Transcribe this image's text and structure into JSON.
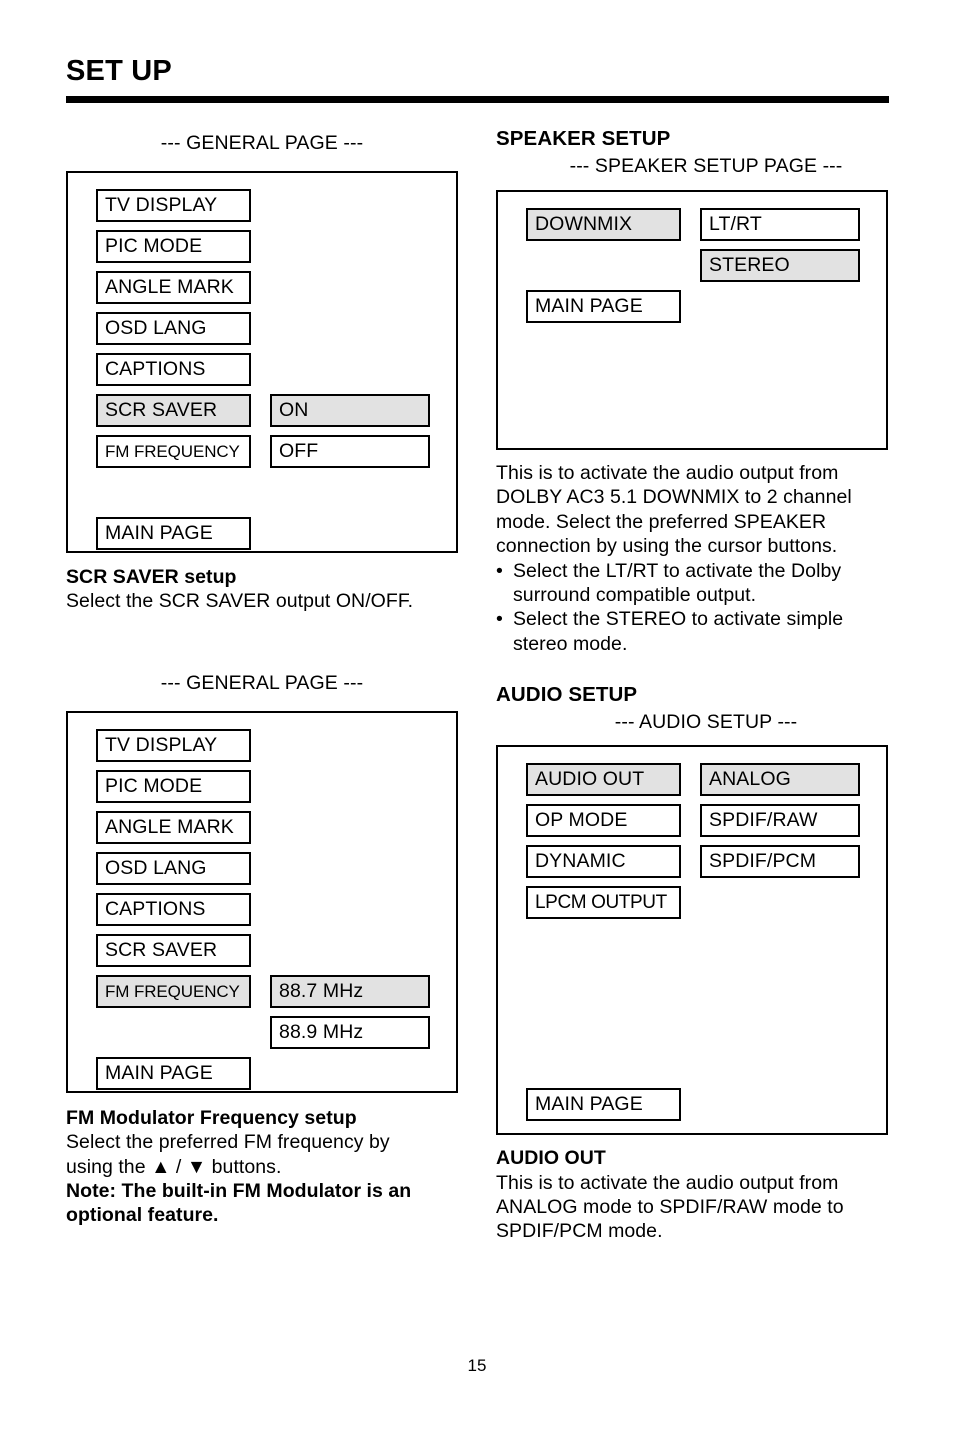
{
  "document": {
    "title": "SET UP",
    "page_number": "15"
  },
  "left_column": {
    "screen1": {
      "caption": "--- GENERAL PAGE ---",
      "menu_items": [
        {
          "label": "TV DISPLAY",
          "selected": false
        },
        {
          "label": "PIC MODE",
          "selected": false
        },
        {
          "label": "ANGLE MARK",
          "selected": false
        },
        {
          "label": "OSD LANG",
          "selected": false
        },
        {
          "label": "CAPTIONS",
          "selected": false
        },
        {
          "label": "SCR SAVER",
          "selected": true
        },
        {
          "label": "FM FREQUENCY",
          "selected": false
        }
      ],
      "main_page_label": "MAIN PAGE",
      "option_items": [
        {
          "label": "ON",
          "selected": true
        },
        {
          "label": "OFF",
          "selected": false
        }
      ]
    },
    "description1": {
      "heading_bold": "SCR SAVER",
      "heading_rest": " setup",
      "line1": "Select the SCR SAVER output ON/OFF."
    },
    "screen2": {
      "caption": "--- GENERAL PAGE ---",
      "menu_items": [
        {
          "label": "TV DISPLAY",
          "selected": false
        },
        {
          "label": "PIC MODE",
          "selected": false
        },
        {
          "label": "ANGLE MARK",
          "selected": false
        },
        {
          "label": "OSD LANG",
          "selected": false
        },
        {
          "label": "CAPTIONS",
          "selected": false
        },
        {
          "label": "SCR SAVER",
          "selected": false
        },
        {
          "label": "FM FREQUENCY",
          "selected": true
        }
      ],
      "main_page_label": "MAIN PAGE",
      "option_items": [
        {
          "label": "88.7 MHz",
          "selected": true
        },
        {
          "label": "88.9 MHz",
          "selected": false
        }
      ]
    },
    "description2": {
      "heading": "FM Modulator Frequency setup",
      "line1": "Select the preferred FM frequency by",
      "line2_pre": "using the ",
      "line2_up": "▲",
      "line2_mid": " / ",
      "line2_down": "▼",
      "line2_post": " buttons.",
      "note_line1": "Note:  The built-in FM Modulator is an",
      "note_line2": "optional feature."
    }
  },
  "right_column": {
    "speaker_setup": {
      "heading": "SPEAKER SETUP",
      "caption": "--- SPEAKER SETUP PAGE ---",
      "menu_items": [
        {
          "label": "DOWNMIX",
          "selected": true
        }
      ],
      "main_page_label": "MAIN PAGE",
      "option_items": [
        {
          "label": "LT/RT",
          "selected": false
        },
        {
          "label": "STEREO",
          "selected": true
        }
      ],
      "description": {
        "line1": "This is to activate the audio output from",
        "line2": "DOLBY AC3 5.1 DOWNMIX to 2 channel",
        "line3": "mode.  Select the preferred SPEAKER",
        "line4": "connection by using the cursor buttons.",
        "bullets": [
          {
            "bullet": "•",
            "line1": "Select the LT/RT to activate the Dolby",
            "line2": "surround compatible output."
          },
          {
            "bullet": "•",
            "line1": "Select the STEREO to activate simple",
            "line2": "stereo mode."
          }
        ]
      }
    },
    "audio_setup": {
      "heading": "AUDIO SETUP",
      "caption": "--- AUDIO SETUP ---",
      "menu_items": [
        {
          "label": "AUDIO OUT",
          "selected": true
        },
        {
          "label": "OP MODE",
          "selected": false
        },
        {
          "label": "DYNAMIC",
          "selected": false
        },
        {
          "label": "LPCM OUTPUT",
          "selected": false
        }
      ],
      "main_page_label": "MAIN PAGE",
      "option_items": [
        {
          "label": "ANALOG",
          "selected": true
        },
        {
          "label": "SPDIF/RAW",
          "selected": false
        },
        {
          "label": "SPDIF/PCM",
          "selected": false
        }
      ],
      "description": {
        "heading": "AUDIO OUT",
        "line1": "This is to activate the audio output from",
        "line2": "ANALOG mode to SPDIF/RAW mode to",
        "line3": "SPDIF/PCM mode."
      }
    }
  },
  "colors": {
    "selected_highlight": "#e2e2e2",
    "border": "#000000",
    "text": "#000000",
    "background": "#ffffff"
  }
}
